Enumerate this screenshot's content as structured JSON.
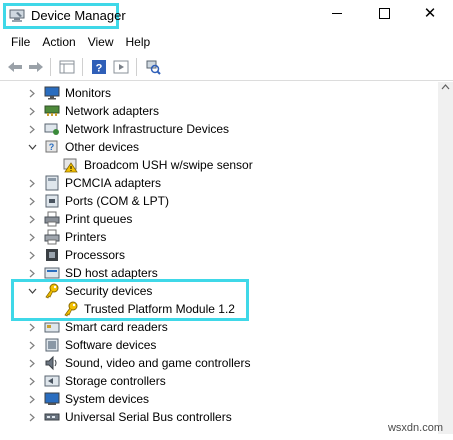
{
  "window": {
    "title": "Device Manager"
  },
  "menu": {
    "file": "File",
    "action": "Action",
    "view": "View",
    "help": "Help"
  },
  "tree": {
    "monitors": "Monitors",
    "network_adapters": "Network adapters",
    "network_infrastructure": "Network Infrastructure Devices",
    "other_devices": "Other devices",
    "broadcom": "Broadcom USH w/swipe sensor",
    "pcmcia": "PCMCIA adapters",
    "ports": "Ports (COM & LPT)",
    "print_queues": "Print queues",
    "printers": "Printers",
    "processors": "Processors",
    "sd_host": "SD host adapters",
    "security_devices": "Security devices",
    "tpm": "Trusted Platform Module 1.2",
    "smart_card": "Smart card readers",
    "software_devices": "Software devices",
    "sound": "Sound, video and game controllers",
    "storage": "Storage controllers",
    "system_devices": "System devices",
    "usb": "Universal Serial Bus controllers"
  },
  "watermark": "wsxdn.com",
  "colors": {
    "highlight": "#3fd8e8",
    "warning": "#f2c000"
  }
}
